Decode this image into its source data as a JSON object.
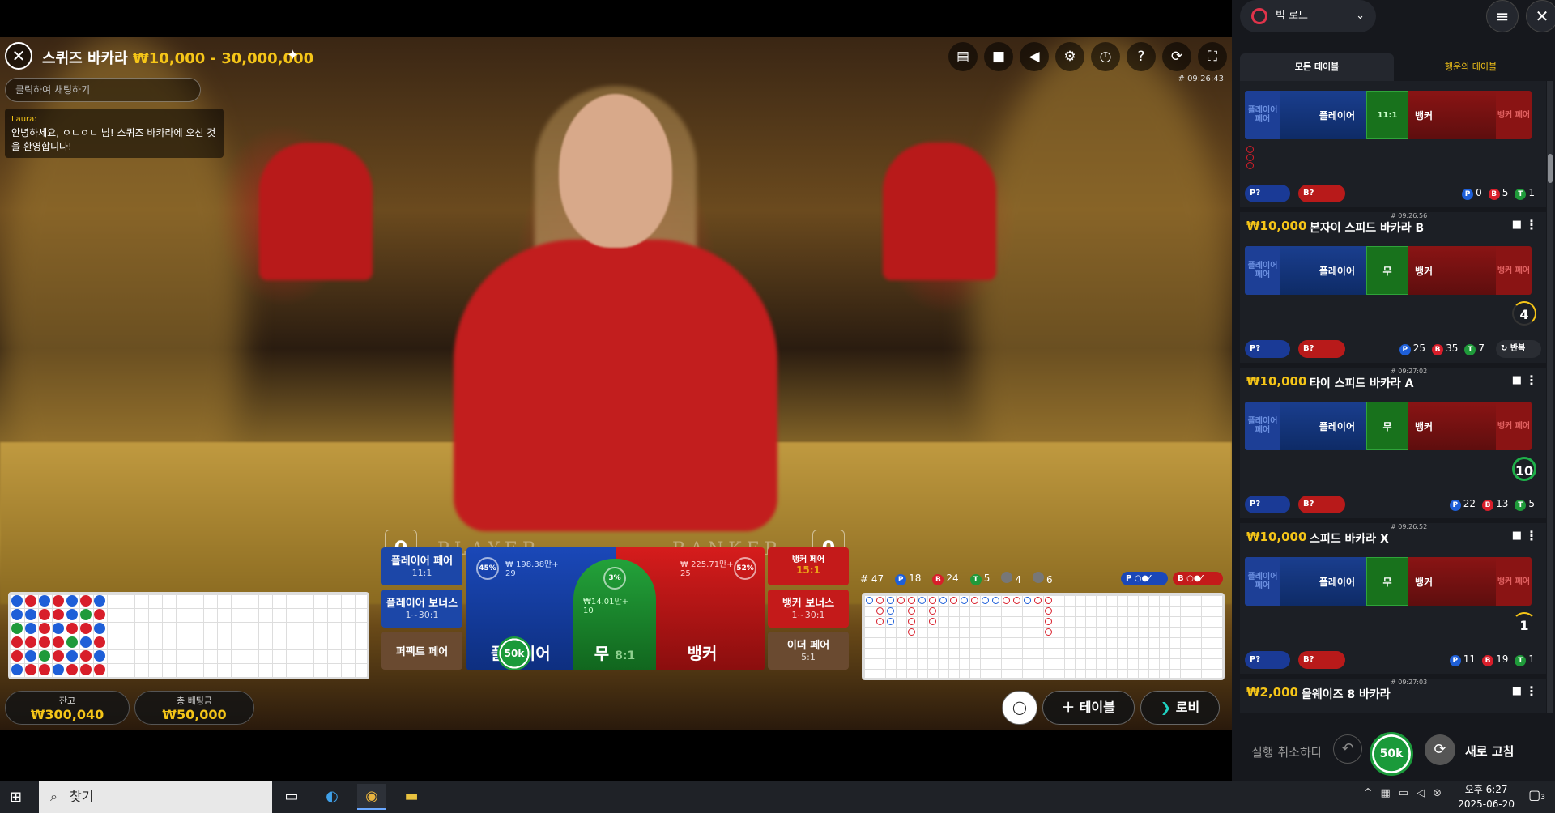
{
  "header": {
    "title": "스퀴즈 바카라",
    "range": "₩10,000 - 30,000,000",
    "time": "# 09:26:43"
  },
  "chat": {
    "placeholder": "클릭하여 채팅하기",
    "author": "Laura:",
    "message": "안녕하세요, ㅇㄴㅇㄴ 님! 스퀴즈 바카라에 오신 것을 환영합니다!"
  },
  "scores": {
    "player": "0",
    "banker": "0"
  },
  "felt": {
    "player": "PLAYER",
    "banker": "BANKER"
  },
  "toolbar": {
    "icons": [
      "chat-icon",
      "video-icon",
      "volume-icon",
      "settings-icon",
      "history-icon",
      "help-icon",
      "rotate-icon",
      "fullscreen-icon"
    ]
  },
  "side_bets": {
    "player_pair": {
      "label": "플레이어 페어",
      "odds": "11:1"
    },
    "player_bonus": {
      "label": "플레이어 보너스",
      "odds": "1~30:1"
    },
    "perfect_pair": {
      "label": "퍼펙트 페어"
    },
    "banker_pair": {
      "label": "뱅커 페어",
      "odds": "15:1"
    },
    "banker_bonus": {
      "label": "뱅커 보너스",
      "odds": "1~30:1"
    },
    "either_pair": {
      "label": "이더 페어",
      "odds": "5:1"
    }
  },
  "main_bets": {
    "player": {
      "label": "플레이어",
      "pct": "45%",
      "amount": "₩ 198.38만+",
      "players": "29"
    },
    "tie": {
      "label": "무",
      "odds": "8:1",
      "pct": "3%",
      "amount": "₩14.01만+",
      "players": "10"
    },
    "banker": {
      "label": "뱅커",
      "pct": "52%",
      "amount": "₩ 225.71만+",
      "players": "25"
    },
    "chip": "50k"
  },
  "road_stats": {
    "round": "# 47",
    "p": "18",
    "b": "24",
    "t": "5",
    "pp": "4",
    "bp": "6"
  },
  "predict": {
    "p": "P",
    "b": "B"
  },
  "balance": {
    "label": "잔고",
    "value": "₩300,040"
  },
  "total_bet": {
    "label": "총 베팅금",
    "value": "₩50,000"
  },
  "bottom_buttons": {
    "tables": "테이블",
    "lobby": "로비"
  },
  "panel": {
    "dropdown": "빅 로드",
    "tabs": [
      "모든 테이블",
      "행운의 테이블"
    ],
    "tables": [
      {
        "bet": "",
        "name": "",
        "time": "",
        "pp": "플레이어 페어",
        "player": "플레이어",
        "tie": "11:1",
        "banker": "뱅커",
        "bp": "뱅커 페어",
        "p": "0",
        "b": "5",
        "t": "1",
        "pred_p": "P?",
        "pred_b": "B?",
        "timer": ""
      },
      {
        "bet": "₩10,000",
        "name": "본자이 스피드 바카라 B",
        "time": "# 09:26:56",
        "pp": "플레이어 페어",
        "player": "플레이어",
        "tie": "무",
        "banker": "뱅커",
        "bp": "뱅커 페어",
        "p": "25",
        "b": "35",
        "t": "7",
        "pred_p": "P?",
        "pred_b": "B?",
        "timer": "4",
        "repeat": "반복"
      },
      {
        "bet": "₩10,000",
        "name": "타이 스피드 바카라 A",
        "time": "# 09:27:02",
        "pp": "플레이어 페어",
        "player": "플레이어",
        "tie": "무",
        "banker": "뱅커",
        "bp": "뱅커 페어",
        "p": "22",
        "b": "13",
        "t": "5",
        "pred_p": "P?",
        "pred_b": "B?",
        "timer": "10"
      },
      {
        "bet": "₩10,000",
        "name": "스피드 바카라 X",
        "time": "# 09:26:52",
        "pp": "플레이어 페어",
        "player": "플레이어",
        "tie": "무",
        "banker": "뱅커",
        "bp": "뱅커 페어",
        "p": "11",
        "b": "19",
        "t": "1",
        "pred_p": "P?",
        "pred_b": "B?",
        "timer": "1"
      },
      {
        "bet": "₩2,000",
        "name": "올웨이즈 8 바카라",
        "time": "# 09:27:03"
      }
    ],
    "undo": "실행 취소하다",
    "chip": "50k",
    "refresh": "새로 고침"
  },
  "taskbar": {
    "search_placeholder": "찾기",
    "time": "오후 6:27",
    "date": "2025-06-20",
    "notifications": "3"
  }
}
